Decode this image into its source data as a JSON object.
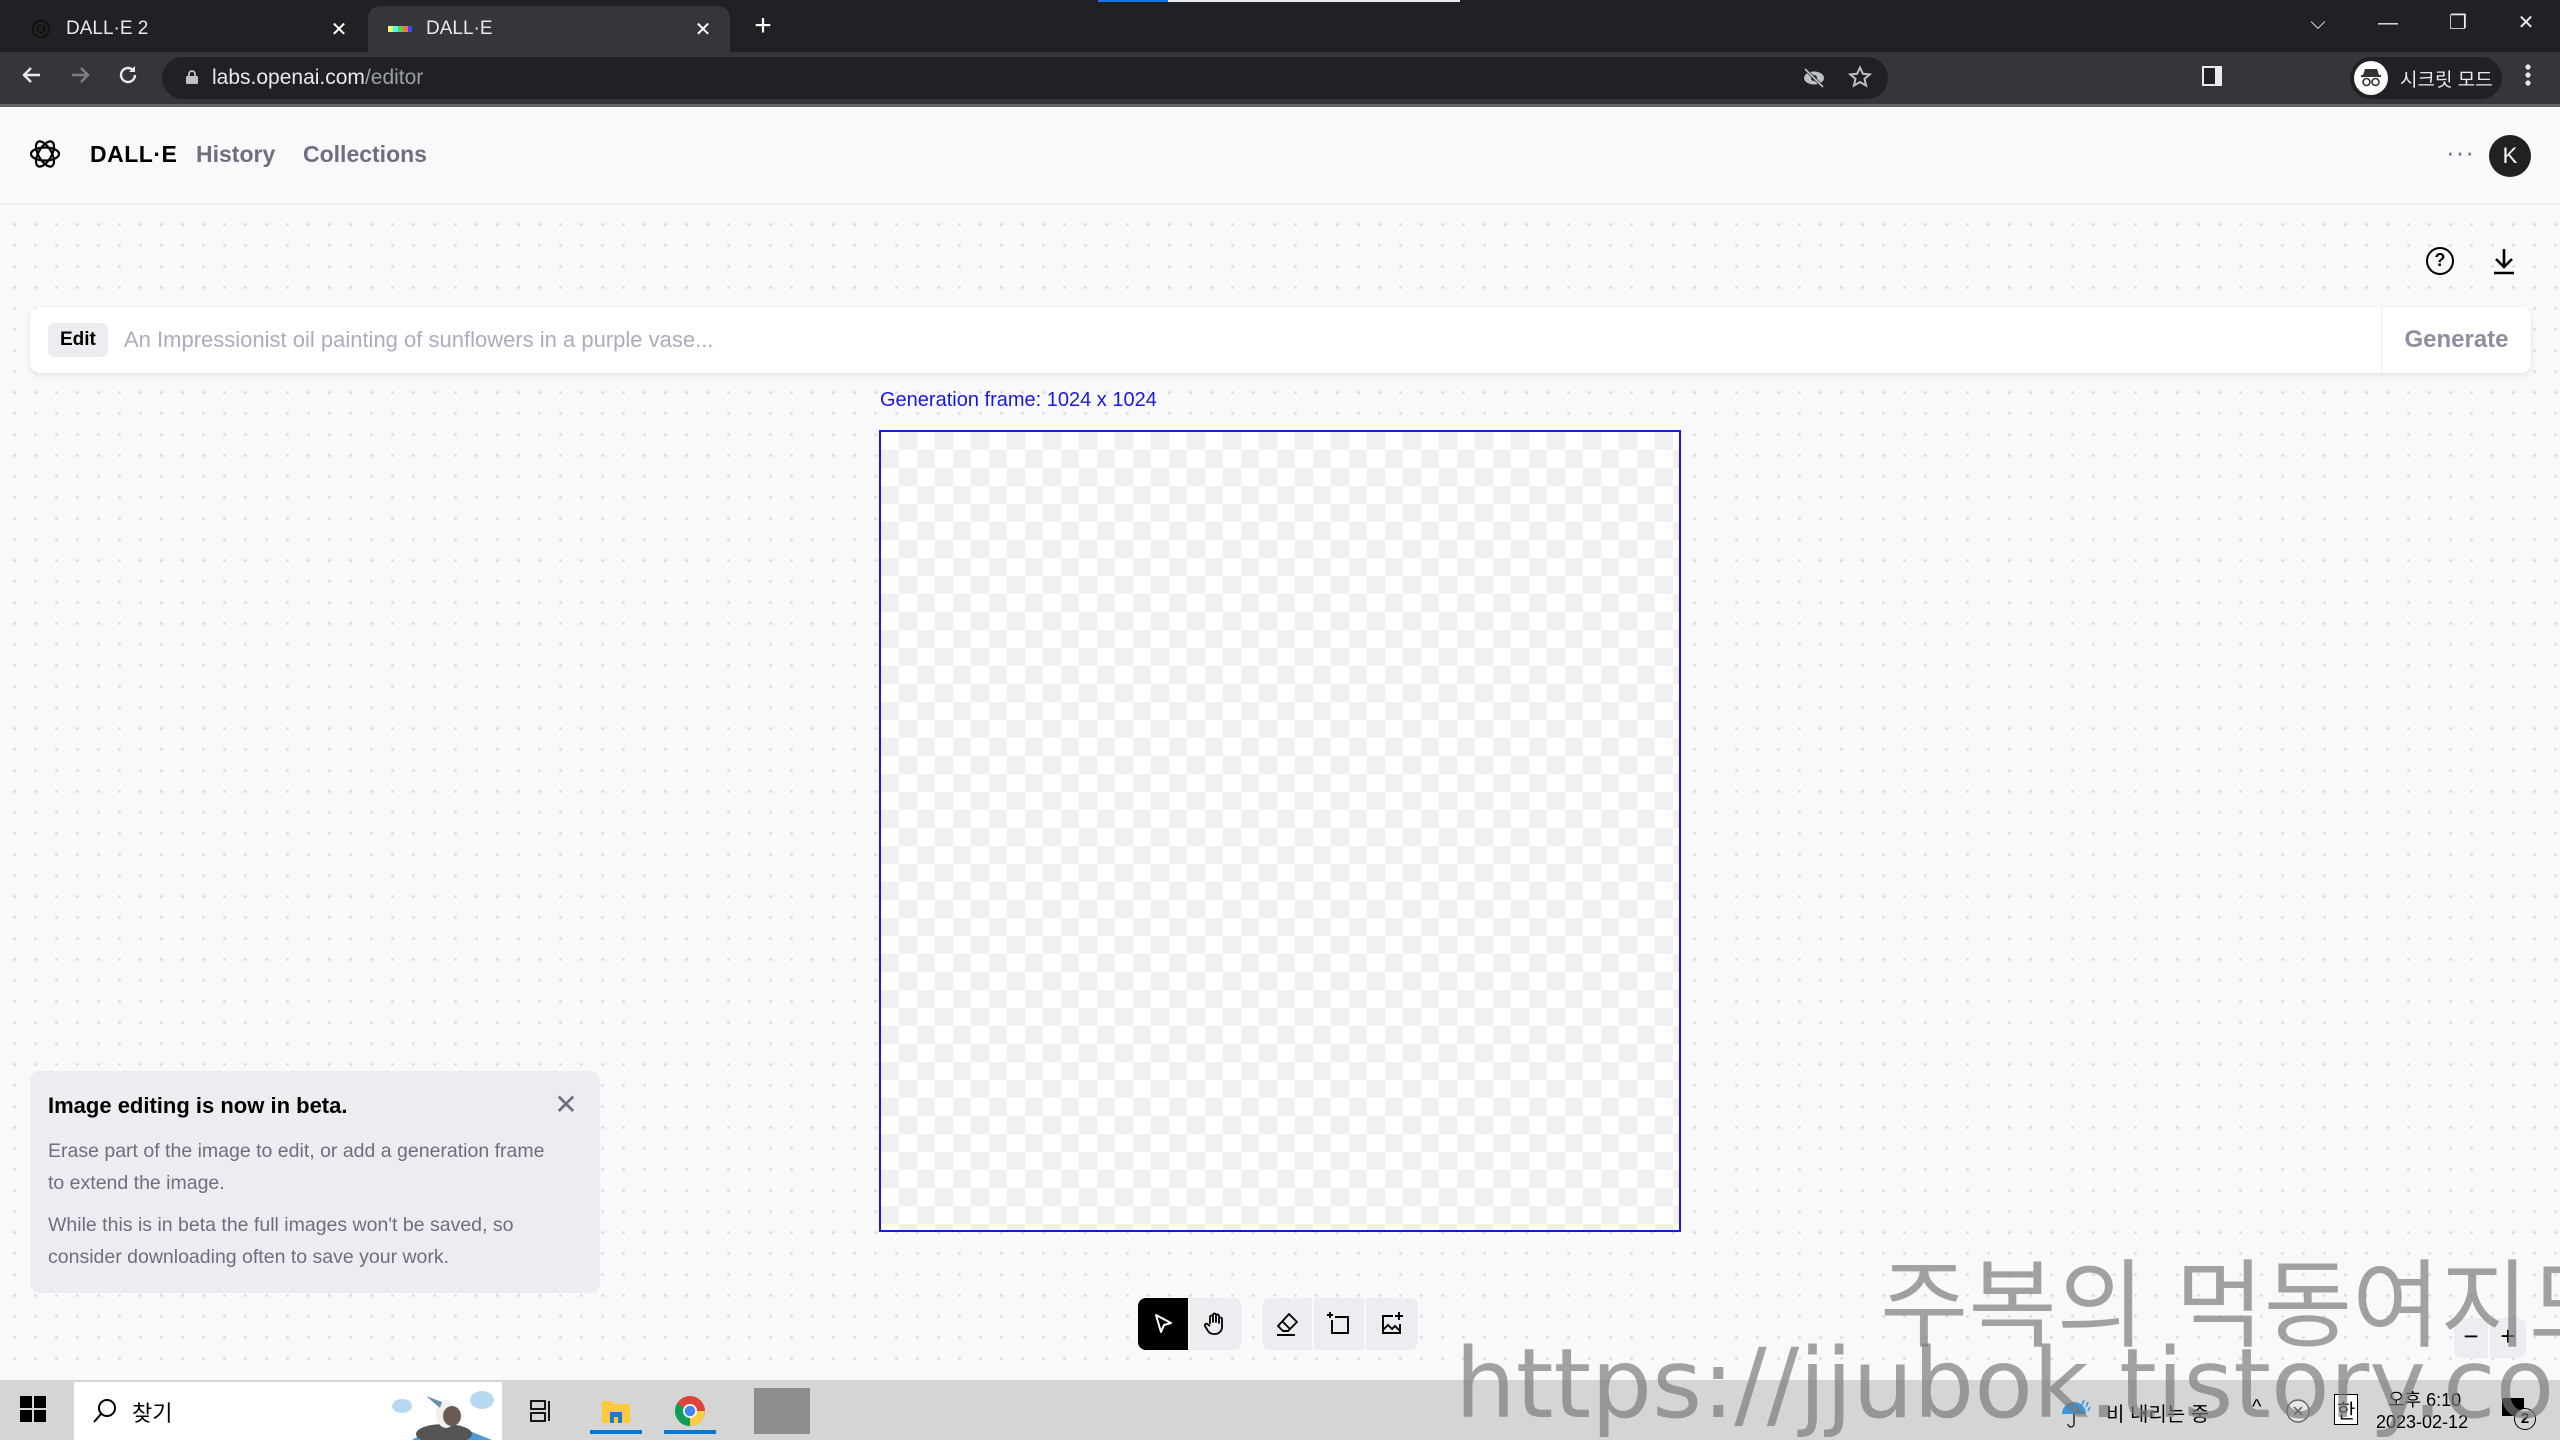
{
  "browser": {
    "tabs": [
      {
        "title": "DALL·E 2",
        "icon": "openai-logo-icon",
        "active": false
      },
      {
        "title": "DALL·E",
        "icon": "dalle-color-strip-icon",
        "active": true
      }
    ],
    "close_glyph": "✕",
    "new_tab_glyph": "+",
    "url_host": "labs.openai.com",
    "url_path": "/editor",
    "incognito_label": "시크릿 모드",
    "window_controls": {
      "tab_search": "⌵",
      "minimize": "—",
      "restore": "❐",
      "close": "✕"
    }
  },
  "app": {
    "brand": "DALL·E",
    "nav": [
      {
        "label": "History"
      },
      {
        "label": "Collections"
      }
    ],
    "more_glyph": "···",
    "avatar_initial": "K",
    "help_glyph": "?",
    "prompt": {
      "mode_badge": "Edit",
      "value": "",
      "placeholder": "An Impressionist oil painting of sunflowers in a purple vase...",
      "generate_label": "Generate"
    },
    "frame_label": "Generation frame: 1024 x 1024",
    "accent_color": "#1919dd",
    "beta_notice": {
      "title": "Image editing is now in beta.",
      "paragraphs": [
        "Erase part of the image to edit, or add a generation frame to extend the image.",
        "While this is in beta the full images won't be saved, so consider downloading often to save your work."
      ],
      "close_glyph": "✕"
    },
    "tools": [
      {
        "name": "select",
        "icon": "cursor-arrow-icon",
        "active": true
      },
      {
        "name": "pan",
        "icon": "hand-icon",
        "active": false
      },
      {
        "name": "eraser",
        "icon": "eraser-icon",
        "active": false
      },
      {
        "name": "add-generation-frame",
        "icon": "add-frame-icon",
        "active": false
      },
      {
        "name": "upload-image",
        "icon": "add-image-icon",
        "active": false
      }
    ],
    "zoom": {
      "out_glyph": "−",
      "in_glyph": "+"
    }
  },
  "taskbar": {
    "search_label": "찾기",
    "weather": "비 내리는 중",
    "ime": "한",
    "time": "오후 6:10",
    "date": "2023-02-12",
    "notifications": "2",
    "tray_chevron": "^"
  },
  "watermark": {
    "line1": "주복의 먹동여지도",
    "line2": "https://jjubok.tistory.com"
  }
}
